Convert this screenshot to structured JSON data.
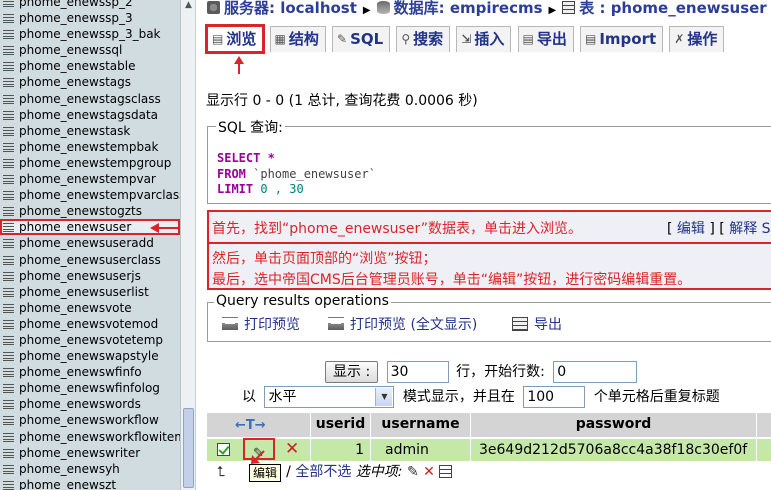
{
  "sidebar": {
    "items": [
      "phome_enewssp_2",
      "phome_enewssp_3",
      "phome_enewssp_3_bak",
      "phome_enewssql",
      "phome_enewstable",
      "phome_enewstags",
      "phome_enewstagsclass",
      "phome_enewstagsdata",
      "phome_enewstask",
      "phome_enewstempbak",
      "phome_enewstempgroup",
      "phome_enewstempvar",
      "phome_enewstempvarclass",
      "phome_enewstogzts",
      "phome_enewsuser",
      "phome_enewsuseradd",
      "phome_enewsuserclass",
      "phome_enewsuserjs",
      "phome_enewsuserlist",
      "phome_enewsvote",
      "phome_enewsvotemod",
      "phome_enewsvotetemp",
      "phome_enewswapstyle",
      "phome_enewswfinfo",
      "phome_enewswfinfolog",
      "phome_enewswords",
      "phome_enewsworkflow",
      "phome_enewsworkflowitem",
      "phome_enewswriter",
      "phome_enewsyh",
      "phome_enewszt"
    ],
    "highlighted": "phome_enewsuser"
  },
  "breadcrumb": {
    "server": "服务器: localhost",
    "database": "数据库: empirecms",
    "table": "表 : phome_enewsuser"
  },
  "tabs": {
    "browse": "浏览",
    "structure": "结构",
    "sql": "SQL",
    "search": "搜索",
    "insert": "插入",
    "export": "导出",
    "import": "Import",
    "operations": "操作"
  },
  "rows_info": "显示行 0 - 0 (1 总计, 查询花费 0.0006 秒)",
  "sql_box": {
    "legend": "SQL 查询:",
    "select_kw": "SELECT",
    "select_rest": " *",
    "from_kw": "FROM",
    "from_rest": " `phome_enewsuser`",
    "limit_kw": "LIMIT",
    "limit_rest": " 0 , 30"
  },
  "annotation": {
    "line1": "首先，找到“phome_enewsuser”数据表，单击进入浏览。",
    "line2": "然后，单击页面顶部的“浏览”按钮；",
    "line3": "最后，选中帝国CMS后台管理员账号，单击“编辑”按钮，进行密码编辑重置。",
    "link_edit": "编辑",
    "link_explain": "解释 S"
  },
  "query_ops": {
    "legend": "Query results operations",
    "print_view": "打印预览",
    "print_view_full": "打印预览 (全文显示)",
    "export": "导出"
  },
  "display": {
    "button": "显示 :",
    "rows_value": "30",
    "start_label": "行，开始行数:",
    "start_value": "0",
    "mode_prefix": "以",
    "mode_value": "水平",
    "mode_suffix": "模式显示，并且在",
    "repeat_value": "100",
    "repeat_suffix": "个单元格后重复标题"
  },
  "results": {
    "columns": [
      "userid",
      "username",
      "password"
    ],
    "rows": [
      {
        "userid": "1",
        "username": "admin",
        "password": "3e649d212d5706a8cc4a38f18c30ef0f"
      }
    ],
    "footer_uncheck_all": "全部不选",
    "footer_with_selected": "选中项:",
    "tooltip": "编辑"
  },
  "colors": {
    "annotation_red": "#d9252a",
    "link_blue": "#223388",
    "row_green": "#c5e8a8",
    "header_gray": "#d4d4d4",
    "sidebar_bg": "#d0dce0"
  }
}
